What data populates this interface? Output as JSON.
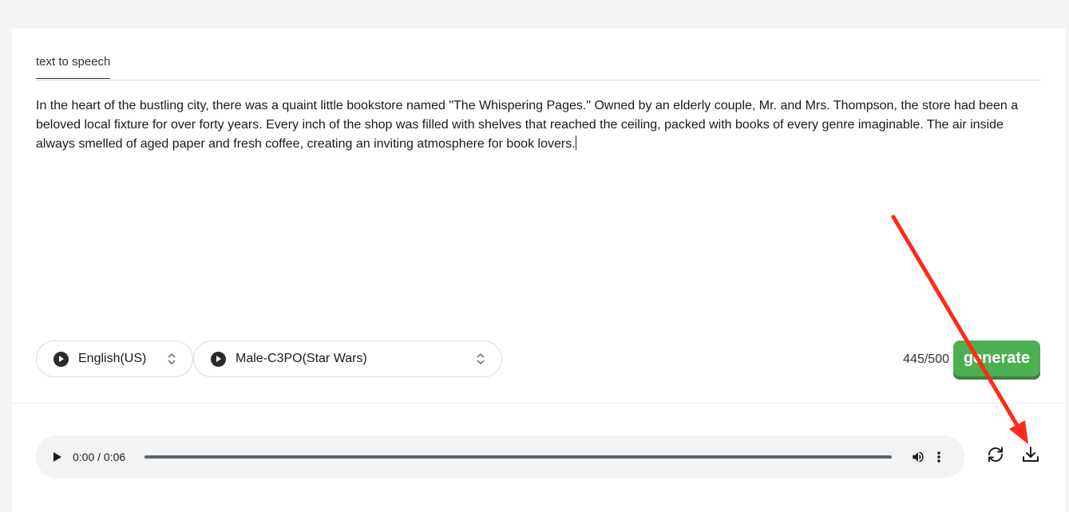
{
  "tabs": [
    {
      "label": "text to speech"
    }
  ],
  "editor": {
    "text": "In the heart of the bustling city, there was a quaint little bookstore named \"The Whispering Pages.\" Owned by an elderly couple, Mr. and Mrs. Thompson, the store had been a beloved local fixture for over forty years. Every inch of the shop was filled with shelves that reached the ceiling, packed with books of every genre imaginable. The air inside always smelled of aged paper and fresh coffee, creating an inviting atmosphere for book lovers."
  },
  "controls": {
    "language": {
      "selected": "English(US)",
      "icon": "play-circle-icon"
    },
    "voice": {
      "selected": "Male-C3PO(Star Wars)",
      "icon": "play-circle-icon"
    },
    "char_count": "445/500",
    "generate_label": "generate",
    "generate_color": "#4caf50"
  },
  "player": {
    "current_time": "0:00",
    "duration": "0:06",
    "time_text": "0:00 / 0:06",
    "progress": 0,
    "icons": [
      "play-icon",
      "volume-icon",
      "more-vert-icon"
    ]
  },
  "actions": {
    "refresh_icon": "refresh-icon",
    "download_icon": "download-icon"
  },
  "annotation": {
    "type": "arrow",
    "color": "#ff2a1a",
    "target": "download-button"
  }
}
